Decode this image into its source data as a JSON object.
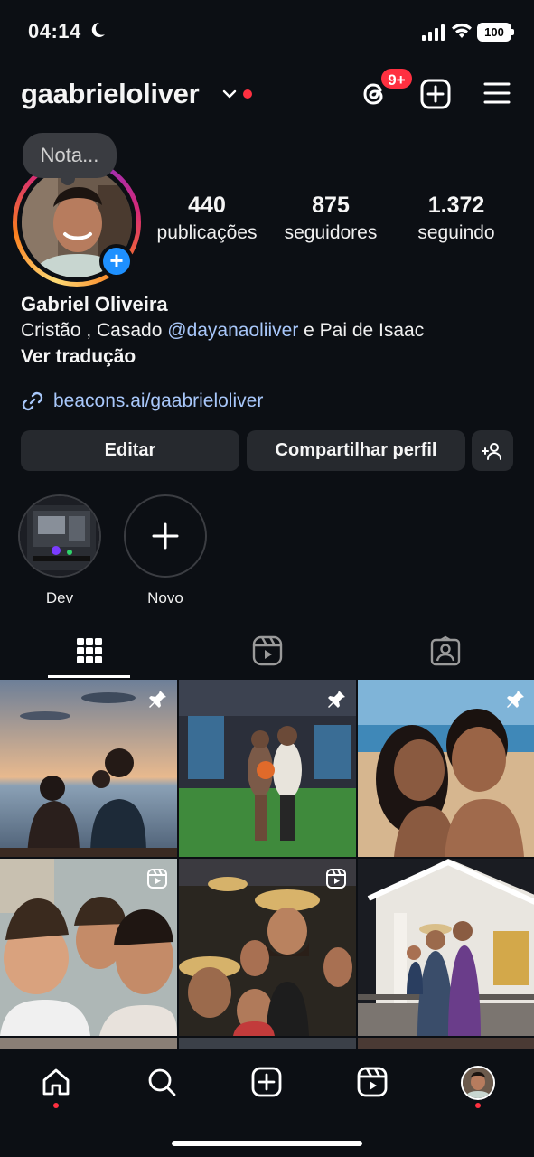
{
  "status_bar": {
    "time": "04:14",
    "battery": "100"
  },
  "header": {
    "username": "gaabrieloliver",
    "threads_badge": "9+"
  },
  "profile": {
    "note_placeholder": "Nota...",
    "stats": [
      {
        "value": "440",
        "label": "publicações"
      },
      {
        "value": "875",
        "label": "seguidores"
      },
      {
        "value": "1.372",
        "label": "seguindo"
      }
    ],
    "full_name": "Gabriel Oliveira",
    "bio_before": "Cristão , Casado ",
    "bio_mention": "@dayanaoliiver",
    "bio_after": " e Pai de Isaac",
    "translate_label": "Ver tradução",
    "link": "beacons.ai/gaabrieloliver"
  },
  "actions": {
    "edit_label": "Editar",
    "share_label": "Compartilhar perfil"
  },
  "highlights": [
    {
      "label": "Dev"
    },
    {
      "label": "Novo"
    }
  ],
  "tabs": [
    "grid-icon",
    "reels-icon",
    "tagged-icon"
  ],
  "grid": [
    {
      "kind": "photo",
      "badge": "pin-icon"
    },
    {
      "kind": "photo",
      "badge": "pin-icon"
    },
    {
      "kind": "photo",
      "badge": "pin-icon"
    },
    {
      "kind": "reel",
      "badge": "reel-icon"
    },
    {
      "kind": "reel",
      "badge": "reel-icon"
    },
    {
      "kind": "photo",
      "badge": ""
    }
  ],
  "bottom_nav": [
    "home-icon",
    "search-icon",
    "create-icon",
    "reels-icon",
    "profile-avatar"
  ],
  "colors": {
    "background": "#0c0f14",
    "button": "#26292e",
    "link": "#a8c7fa",
    "accent_red": "#ff3040",
    "plus_blue": "#1e90ff"
  }
}
